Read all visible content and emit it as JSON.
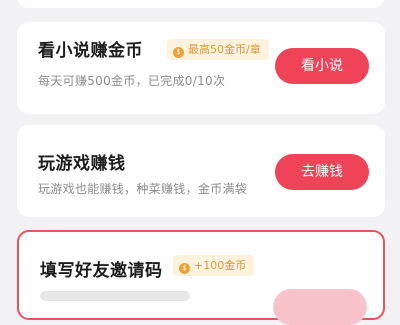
{
  "tasks": [
    {
      "title": "看小说赚金币",
      "badge": "最高50金币/章",
      "description": "每天可赚500金币，已完成0/10次",
      "button": "看小说"
    },
    {
      "title": "玩游戏赚钱",
      "description": "玩游戏也能赚钱，种菜赚钱，金币满袋",
      "button": "去赚钱"
    },
    {
      "title": "填写好友邀请码",
      "badge": "+100金币"
    }
  ],
  "colors": {
    "accent": "#ef4458",
    "badge_text": "#d89a38",
    "badge_bg": "#fdf2de",
    "highlight_border": "#e9545c"
  },
  "icons": {
    "coin": "coin-icon"
  }
}
